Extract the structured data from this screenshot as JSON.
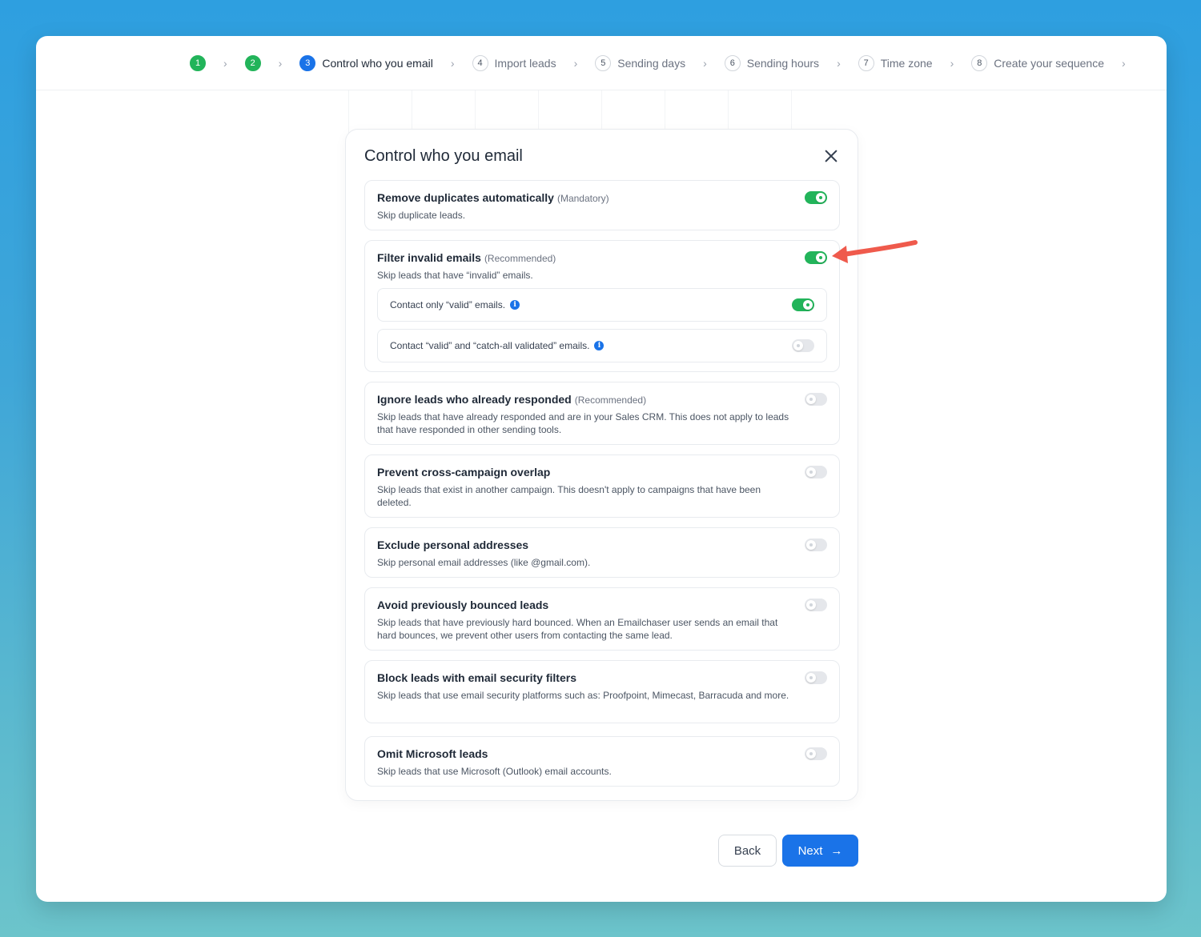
{
  "stepper": {
    "steps": [
      {
        "number": "1",
        "label": ""
      },
      {
        "number": "2",
        "label": ""
      },
      {
        "number": "3",
        "label": "Control who you email"
      },
      {
        "number": "4",
        "label": "Import leads"
      },
      {
        "number": "5",
        "label": "Sending days"
      },
      {
        "number": "6",
        "label": "Sending hours"
      },
      {
        "number": "7",
        "label": "Time zone"
      },
      {
        "number": "8",
        "label": "Create your sequence"
      }
    ],
    "chevron": "›"
  },
  "modal": {
    "title": "Control who you email",
    "cards": [
      {
        "title": "Remove duplicates automatically",
        "tag": "(Mandatory)",
        "desc": "Skip duplicate leads.",
        "enabled": true
      },
      {
        "title": "Filter invalid emails",
        "tag": "(Recommended)",
        "desc": "Skip leads that have “invalid” emails.",
        "enabled": true,
        "options": [
          {
            "label": "Contact only “valid” emails.",
            "enabled": true
          },
          {
            "label": "Contact “valid” and “catch-all validated” emails.",
            "enabled": false
          }
        ]
      },
      {
        "title": "Ignore leads who already responded",
        "tag": "(Recommended)",
        "desc": "Skip leads that have already responded and are in your Sales CRM. This does not apply to leads that have responded in other sending tools.",
        "enabled": false
      },
      {
        "title": "Prevent cross-campaign overlap",
        "tag": "",
        "desc": "Skip leads that exist in another campaign. This doesn't apply to campaigns that have been deleted.",
        "enabled": false
      },
      {
        "title": "Exclude personal addresses",
        "tag": "",
        "desc": "Skip personal email addresses (like @gmail.com).",
        "enabled": false
      },
      {
        "title": "Avoid previously bounced leads",
        "tag": "",
        "desc": "Skip leads that have previously hard bounced. When an Emailchaser user sends an email that hard bounces, we prevent other users from contacting the same lead.",
        "enabled": false
      },
      {
        "title": "Block leads with email security filters",
        "tag": "",
        "desc": "Skip leads that use email security platforms such as: Proofpoint, Mimecast, Barracuda and more.",
        "enabled": false
      },
      {
        "title": "Omit Microsoft leads",
        "tag": "",
        "desc": "Skip leads that use Microsoft (Outlook) email accounts.",
        "enabled": false
      }
    ]
  },
  "footer": {
    "back_label": "Back",
    "next_label": "Next",
    "next_icon": "→"
  },
  "colors": {
    "accent": "#1a73e8",
    "success": "#22b45a",
    "annotation_arrow": "#ef5a4c"
  }
}
